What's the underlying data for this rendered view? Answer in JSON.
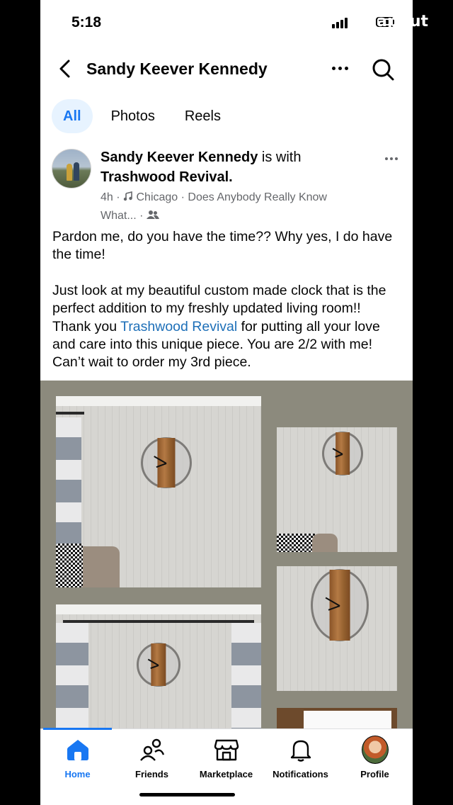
{
  "status_bar": {
    "time": "5:18",
    "watermark": "CapCut"
  },
  "header": {
    "title": "Sandy Keever Kennedy"
  },
  "tabs": [
    {
      "label": "All",
      "active": true
    },
    {
      "label": "Photos",
      "active": false
    },
    {
      "label": "Reels",
      "active": false
    }
  ],
  "post": {
    "author": "Sandy Keever Kennedy",
    "with_text": "is with",
    "tagged": "Trashwood Revival.",
    "time": "4h",
    "separator": "·",
    "music": "Chicago · Does Anybody Really Know",
    "music_cont": "What...",
    "paragraph1": "Pardon me, do you have the time?? Why yes, I do have the time!",
    "paragraph2_a": "Just look at my beautiful custom made clock that is the perfect addition to my freshly updated living room!! Thank you ",
    "paragraph2_link": "Trashwood Revival",
    "paragraph2_b": " for putting all your love and care into this unique piece.  You are 2/2 with me!  Can’t wait to order my 3rd piece."
  },
  "bottom_nav": [
    {
      "label": "Home",
      "icon": "home-icon",
      "active": true
    },
    {
      "label": "Friends",
      "icon": "friends-icon",
      "active": false
    },
    {
      "label": "Marketplace",
      "icon": "marketplace-icon",
      "active": false
    },
    {
      "label": "Notifications",
      "icon": "bell-icon",
      "active": false
    },
    {
      "label": "Profile",
      "icon": "profile-avatar",
      "active": false
    }
  ],
  "colors": {
    "accent": "#1877f2",
    "link": "#1d6fb8",
    "secondary_text": "#65676b",
    "photo_background": "#8c8a7d"
  }
}
